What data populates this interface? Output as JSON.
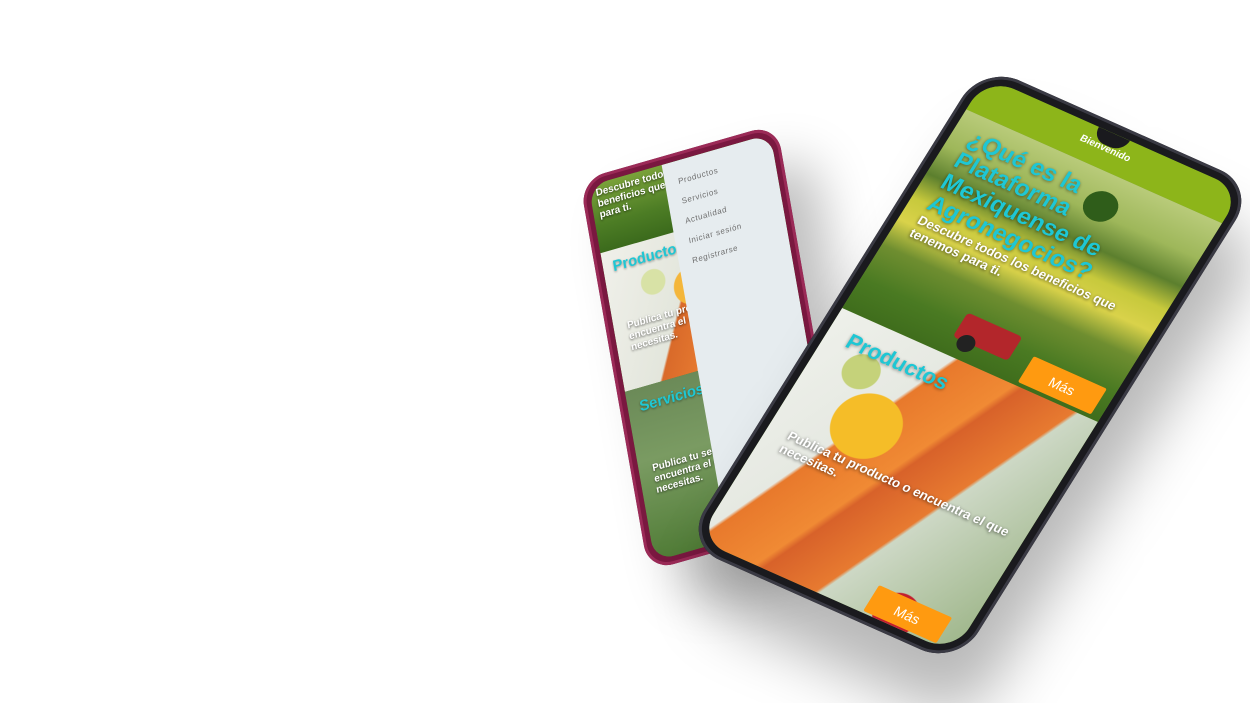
{
  "back_phone": {
    "hero_text": "Descubre todos los beneficios que tenemos para ti.",
    "products_title": "Productos",
    "products_text": "Publica tu producto o encuentra el que necesitas.",
    "services_title": "Servicios",
    "services_text": "Publica tu servicio o encuentra el que necesitas.",
    "menu": {
      "items": [
        "Productos",
        "Servicios",
        "Actualidad",
        "Iniciar sesión",
        "Registrarse"
      ]
    }
  },
  "front_phone": {
    "welcome": "Bienvenido",
    "question": "¿Qué es la Plataforma Mexiquense de Agronegocios?",
    "hero_text": "Descubre todos los beneficios que tenemos para ti.",
    "more_label": "Más",
    "products_title": "Productos",
    "products_text": "Publica tu producto o encuentra el que necesitas.",
    "products_more_label": "Más"
  },
  "colors": {
    "accent_title": "#1ec7d4",
    "button": "#ff9a10",
    "topbar": "#8db51a",
    "back_phone_body": "#7a1840"
  }
}
